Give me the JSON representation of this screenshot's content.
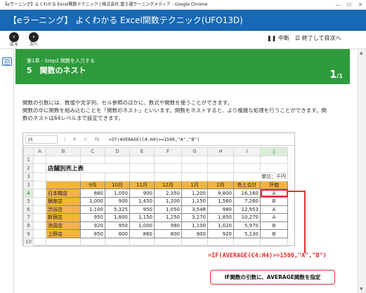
{
  "window": {
    "title": "【eラーニング】よくわかる Excel関数テクニック | 株式会社 富士通ラーニングメディア - Google Chrome",
    "min": "—",
    "max": "☐",
    "close": "✕"
  },
  "brand": {
    "title": "【eラーニング】 よくわかる Excel関数テクニック(UFO13D)"
  },
  "nav": {
    "back_label": "戻る",
    "next_label": "次へ",
    "pause_label": "中断",
    "exit_label": "終了して目次へ"
  },
  "chapter": {
    "chapter_label": "第1章 - Step2 関数を入力する",
    "title": "5　関数のネスト",
    "page_current": "1",
    "page_total": "/1"
  },
  "description": [
    "関数の引数には、数値や文字列、セル参照のほかに、数式や関数を使うことができます。",
    "関数の中に関数を組み込むことを「関数のネスト」といいます。関数をネストすると、より複雑な処理を行うことができます。関",
    "数のネストは64レベルまで設定できます。"
  ],
  "excel": {
    "name_box": "J4",
    "formula": "=IF(AVERAGE(C4:H4)>=1500,\"A\",\"B\")",
    "columns": [
      "",
      "A",
      "B",
      "C",
      "D",
      "E",
      "F",
      "G",
      "H",
      "I",
      "J"
    ],
    "sheet_title": "店舗別売上表",
    "unit": "単位：千円",
    "header_row": [
      "9月",
      "10月",
      "11月",
      "12月",
      "1月",
      "2月",
      "売上合計",
      "評価"
    ],
    "rows": [
      {
        "num": "4",
        "store": "日本橋店",
        "values": [
          "860",
          "1,050",
          "900",
          "2,350",
          "1,200",
          "9,800",
          "16,160"
        ],
        "rank": "A"
      },
      {
        "num": "5",
        "store": "銀座店",
        "values": [
          "1,000",
          "900",
          "1,450",
          "1,200",
          "1,150",
          "1,560",
          "7,260"
        ],
        "rank": "B"
      },
      {
        "num": "6",
        "store": "渋谷店",
        "values": [
          "1,100",
          "5,325",
          "950",
          "1,050",
          "3,548",
          "980",
          "12,953"
        ],
        "rank": "A"
      },
      {
        "num": "7",
        "store": "新宿店",
        "values": [
          "950",
          "1,800",
          "1,150",
          "1,250",
          "3,270",
          "1,850",
          "10,270"
        ],
        "rank": "A"
      },
      {
        "num": "8",
        "store": "池袋店",
        "values": [
          "920",
          "950",
          "1,000",
          "980",
          "1,100",
          "1,020",
          "5,970"
        ],
        "rank": "B"
      },
      {
        "num": "9",
        "store": "上野店",
        "values": [
          "850",
          "800",
          "860",
          "800",
          "900",
          "920",
          "5,130"
        ],
        "rank": "B"
      }
    ]
  },
  "annotation": {
    "formula": "=IF(AVERAGE(C4:H4)>=1500,\"A\",\"B\")",
    "callout": "IF関数の引数に、AVERAGE関数を指定"
  },
  "colors": {
    "brand": "#1868b5",
    "chapter": "#2e9b3c",
    "cell_orange": "#f5b43c",
    "annotation_red": "#e03030"
  }
}
